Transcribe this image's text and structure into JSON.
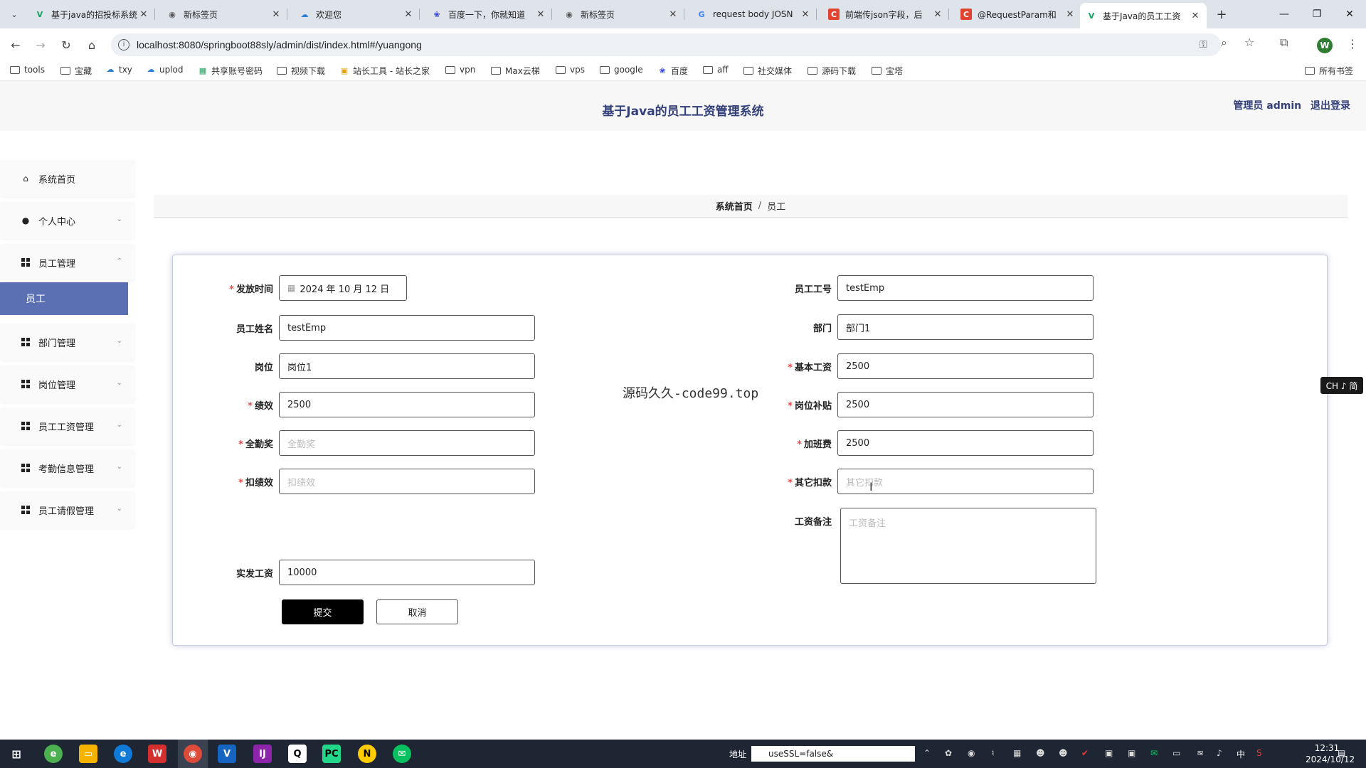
{
  "browser": {
    "tabs": [
      {
        "title": "基于java的招投标系统",
        "fav": "V",
        "color": "#1aa260"
      },
      {
        "title": "新标签页",
        "fav": "◉",
        "color": "#555555"
      },
      {
        "title": "欢迎您",
        "fav": "☁",
        "color": "#2a7fd4"
      },
      {
        "title": "百度一下，你就知道",
        "fav": "❀",
        "color": "#3245df"
      },
      {
        "title": "新标签页",
        "fav": "◉",
        "color": "#555555"
      },
      {
        "title": "request body JOSN",
        "fav": "G",
        "color": "#4285f4"
      },
      {
        "title": "前端传json字段，后",
        "fav": "C",
        "color": "#e0432f"
      },
      {
        "title": "@RequestParam和",
        "fav": "C",
        "color": "#e0432f"
      },
      {
        "title": "基于Java的员工工资",
        "fav": "V",
        "color": "#1aa260"
      }
    ],
    "url": "localhost:8080/springboot88sly/admin/dist/index.html#/yuangong",
    "avatar_letter": "W",
    "bookmarks": [
      "tools",
      "宝藏",
      "txy",
      "uplod",
      "共享账号密码",
      "视频下载",
      "站长工具 - 站长之家",
      "vpn",
      "Max云梯",
      "vps",
      "google",
      "百度",
      "aff",
      "社交媒体",
      "源码下载",
      "宝塔"
    ],
    "all_bookmarks": "所有书签"
  },
  "app": {
    "title": "基于Java的员工工资管理系统",
    "user": "管理员 admin",
    "logout": "退出登录"
  },
  "sidebar": {
    "items": [
      {
        "label": "系统首页",
        "icon": "home-icon"
      },
      {
        "label": "个人中心",
        "icon": "person-icon"
      },
      {
        "label": "员工管理",
        "icon": "grid-icon"
      },
      {
        "label": "部门管理",
        "icon": "grid-icon"
      },
      {
        "label": "岗位管理",
        "icon": "grid-icon"
      },
      {
        "label": "员工工资管理",
        "icon": "grid-icon"
      },
      {
        "label": "考勤信息管理",
        "icon": "grid-icon"
      },
      {
        "label": "员工请假管理",
        "icon": "grid-icon"
      }
    ],
    "active_sub": "员工"
  },
  "breadcrumb": {
    "home": "系统首页",
    "sep": "/",
    "current": "员工"
  },
  "form": {
    "issue_date": {
      "label": "发放时间",
      "value": "2024 年 10 月 12 日"
    },
    "emp_no": {
      "label": "员工工号",
      "value": "testEmp"
    },
    "emp_name": {
      "label": "员工姓名",
      "value": "testEmp"
    },
    "dept": {
      "label": "部门",
      "value": "部门1"
    },
    "post": {
      "label": "岗位",
      "value": "岗位1"
    },
    "base_salary": {
      "label": "基本工资",
      "value": "2500"
    },
    "performance": {
      "label": "绩效",
      "value": "2500"
    },
    "post_allowance": {
      "label": "岗位补贴",
      "value": "2500"
    },
    "attendance_bonus": {
      "label": "全勤奖",
      "placeholder": "全勤奖"
    },
    "overtime": {
      "label": "加班费",
      "value": "2500"
    },
    "perf_deduct": {
      "label": "扣绩效",
      "placeholder": "扣绩效"
    },
    "other_deduct": {
      "label": "其它扣款",
      "placeholder": "其它扣款"
    },
    "remark": {
      "label": "工资备注",
      "placeholder": "工资备注"
    },
    "net_salary": {
      "label": "实发工资",
      "value": "10000"
    },
    "submit": "提交",
    "cancel": "取消"
  },
  "watermark": "源码久久-code99.top",
  "ime": "CH ♪ 简",
  "taskbar": {
    "addr_label": "地址",
    "addr_value": "useSSL=false&",
    "time": "12:31",
    "date": "2024/10/12",
    "lang": "中"
  }
}
